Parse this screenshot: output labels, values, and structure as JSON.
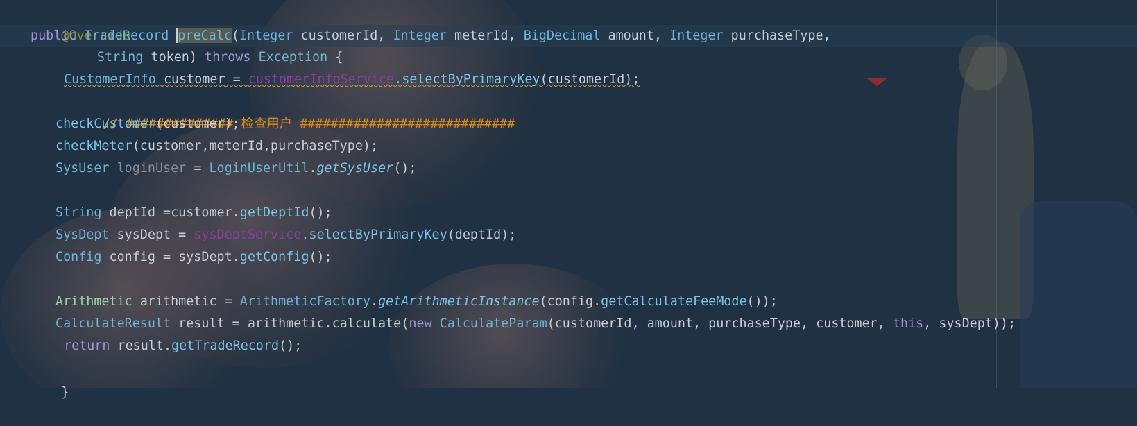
{
  "editor": {
    "lines": {
      "l1": {
        "annotation": "@Override"
      },
      "l2": {
        "kw_public": "public",
        "ret_type": "TradeRecord",
        "method_name": "preCalc",
        "p_open": "(",
        "t_integer1": "Integer",
        "p_customer": " customerId, ",
        "t_integer2": "Integer",
        "p_meter": " meterId, ",
        "t_bigdecimal": "BigDecimal",
        "p_amount": " amount, ",
        "t_integer3": "Integer",
        "p_purchase": " purchaseType,"
      },
      "l3": {
        "t_string": "String",
        "p_token": " token) ",
        "kw_throws": "throws",
        "exc": " Exception",
        "brace": " {"
      },
      "l4": {
        "t_customerinfo": "CustomerInfo",
        "var_customer": " customer",
        "eq": " = ",
        "field": "customerInfoService",
        "call": ".selectByPrimaryKey",
        "args": "(customerId);"
      },
      "l5": {
        "comment": "// ############## 检查用户 ############################"
      },
      "l6": {
        "fn": "checkCustomer",
        "args": "(customer);"
      },
      "l7": {
        "fn": "checkMeter",
        "args": "(customer,meterId,purchaseType);"
      },
      "l8": {
        "t_sysuser": "SysUser",
        "sp": " ",
        "var_unused": "loginUser",
        "eq": " = ",
        "cls": "LoginUserUtil",
        "dot": ".",
        "static_fn": "getSysUser",
        "args": "();"
      },
      "l10": {
        "t_string": "String",
        "rest1": " deptId =customer.",
        "fn": "getDeptId",
        "args": "();"
      },
      "l11": {
        "t_sysdept": "SysDept",
        "rest1": " sysDept = ",
        "field": "sysDeptService",
        "call": ".selectByPrimaryKey",
        "args": "(deptId);"
      },
      "l12": {
        "t_config": "Config",
        "rest1": " config = sysDept.",
        "fn": "getConfig",
        "args": "();"
      },
      "l14": {
        "t_arith": "Arithmetic",
        "rest1": " arithmetic = ",
        "cls": "ArithmeticFactory",
        "dot": ".",
        "static_fn": "getArithmeticInstance",
        "rest2": "(config.",
        "fn": "getCalculateFeeMode",
        "args": "());"
      },
      "l15": {
        "t_calcres": "CalculateResult",
        "rest1": " result = arithmetic.calculate(",
        "kw_new": "new",
        "sp": " ",
        "cls": "CalculateParam",
        "rest2": "(customerId, amount, purchaseType, customer, ",
        "kw_this": "this",
        "args": ", sysDept));"
      },
      "l16": {
        "kw_return": "return",
        "rest1": " result.",
        "fn": "getTradeRecord",
        "args": "();"
      },
      "l17": {
        "brace": "}"
      }
    }
  },
  "colors": {
    "background": "#1f3142",
    "keyword": "#a292d8",
    "type": "#6fb4d8",
    "text": "#c8ccd4",
    "method": "#7cc4e8",
    "field": "#8a3da8",
    "comment": "#d98a1a",
    "annotation": "#7f8c3a",
    "green_type": "#98d4a0"
  }
}
